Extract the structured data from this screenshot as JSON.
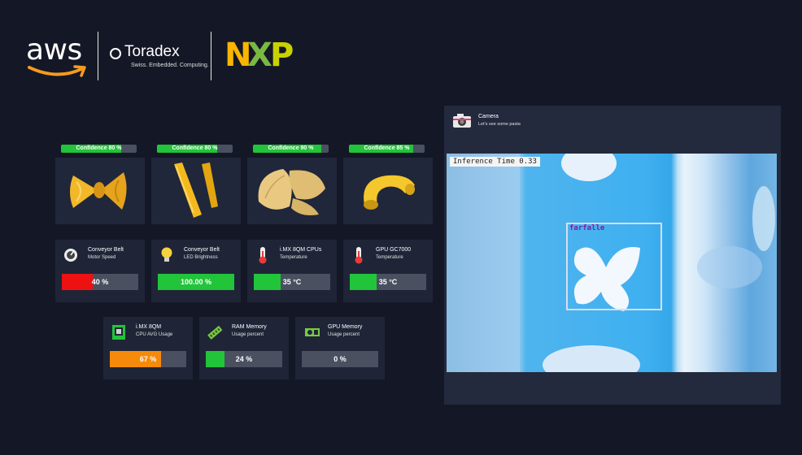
{
  "logos": {
    "aws": "aws",
    "toradex": "Toradex",
    "toradex_tagline": "Swiss. Embedded. Computing.",
    "nxp": [
      "N",
      "X",
      "P"
    ]
  },
  "colors": {
    "accent_green": "#22c43a",
    "accent_red": "#ee1111",
    "accent_orange": "#f78a0a",
    "track": "#4b5060",
    "card": "#1f2537"
  },
  "pasta": [
    {
      "confidence_label": "Confidence 80 %",
      "confidence": 0.8,
      "image": "farfalle-image"
    },
    {
      "confidence_label": "Confidence 80 %",
      "confidence": 0.8,
      "image": "penne-image"
    },
    {
      "confidence_label": "Confidence 90 %",
      "confidence": 0.9,
      "image": "conchiglie-image"
    },
    {
      "confidence_label": "Confidence 85 %",
      "confidence": 0.85,
      "image": "elbow-macaroni-image"
    }
  ],
  "metrics_row1": [
    {
      "title": "Conveyor Belt",
      "subtitle": "Motor Speed",
      "value_label": "40 %",
      "fraction": 0.4,
      "color": "#ee1111",
      "icon": "motor-gauge-icon"
    },
    {
      "title": "Conveyor Belt",
      "subtitle": "LED Brightness",
      "value_label": "100.00 %",
      "fraction": 1.0,
      "color": "#22c43a",
      "icon": "light-bulb-icon"
    },
    {
      "title": "i.MX 8QM CPUs",
      "subtitle": "Temperature",
      "value_label": "35 °C",
      "fraction": 0.35,
      "color": "#22c43a",
      "icon": "thermometer-icon"
    },
    {
      "title": "GPU GC7000",
      "subtitle": "Temperature",
      "value_label": "35 °C",
      "fraction": 0.35,
      "color": "#22c43a",
      "icon": "thermometer-icon"
    }
  ],
  "metrics_row2": [
    {
      "title": "i.MX 8QM",
      "subtitle": "CPU AVG Usage",
      "value_label": "67 %",
      "fraction": 0.67,
      "color": "#f78a0a",
      "icon": "cpu-chip-icon"
    },
    {
      "title": "RAM Memory",
      "subtitle": "Usage percent",
      "value_label": "24 %",
      "fraction": 0.24,
      "color": "#22c43a",
      "icon": "ram-icon"
    },
    {
      "title": "GPU Memory",
      "subtitle": "Usage percent",
      "value_label": "0 %",
      "fraction": 0.0,
      "color": "#22c43a",
      "icon": "gpu-card-icon"
    }
  ],
  "camera": {
    "title": "Camera",
    "subtitle": "Let's see some pasta",
    "inference_label": "Inference Time 0.33",
    "detection_label": "farfalle"
  }
}
